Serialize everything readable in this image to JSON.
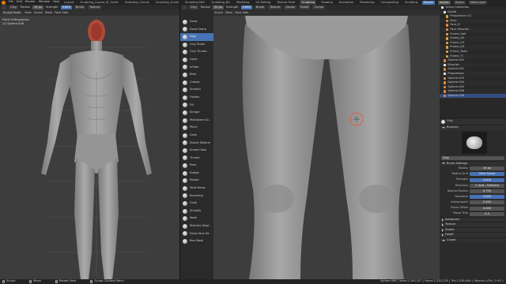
{
  "topbar": {
    "menus": [
      "File",
      "Edit",
      "Render",
      "Window",
      "Help"
    ],
    "workspaces": [
      "Layout",
      "Sculpting_Course_M_Guide",
      "Sculpting_Course",
      "Sculpting_Guide",
      "Sculpting Mini",
      "Sculpting_BG",
      "Modeling",
      "UV Editing",
      "Texture Paint",
      "Shading",
      "Animation",
      "Rendering",
      "Compositing",
      "Scripting"
    ],
    "active_workspace": "Sculpting",
    "scene": "Scene",
    "view_layer": "View Layer",
    "buttons": [
      "Export",
      "Import"
    ]
  },
  "left_header": {
    "brush": "Clay",
    "radius_label": "Radius",
    "radius": "34 px",
    "strength_label": "Strength",
    "strength": "0.600",
    "brush_menu": "Brush",
    "texture_menu": "Texture"
  },
  "left_subheader": {
    "mode": "Sculpt Mode",
    "menus": [
      "View",
      "Sculpt",
      "Mask",
      "Face Sets"
    ]
  },
  "left_viewport": {
    "view": "Front Orthographic",
    "object": "(1) Sphere.008"
  },
  "right_header": {
    "brush": "Clay",
    "radius_label": "Radius",
    "radius": "34 px",
    "strength_label": "Strength",
    "strength": "0.600",
    "brush_menu": "Brush",
    "texture_menu": "Texture",
    "stroke_menu": "Stroke",
    "falloff_menu": "Falloff",
    "cursor_menu": "Cursor"
  },
  "right_subheader": {
    "mode": "Sculpt Mode",
    "menus": [
      "View",
      "Sculpt",
      "Mask",
      "Face Sets"
    ]
  },
  "right_viewport": {
    "view": "Front Orthographic",
    "object": "(1) Sphere.008"
  },
  "tools": [
    "Draw",
    "Draw Sharp",
    "Clay",
    "Clay Strips",
    "Clay Thumb",
    "Layer",
    "Inflate",
    "Blob",
    "Crease",
    "Smooth",
    "Flatten",
    "Fill",
    "Scrape",
    "Multiplane Sc..",
    "Pinch",
    "Grab",
    "Elastic Deform",
    "Snake Hook",
    "Thumb",
    "Pose",
    "Nudge",
    "Rotate",
    "Slide Relax",
    "Boundary",
    "Cloth",
    "Simplify",
    "Mask",
    "Multires Displ..",
    "Draw Face Se..",
    "Box Mask"
  ],
  "active_tool": "Clay",
  "outliner": {
    "title": "Scene Collection",
    "rows": [
      "Scene Collection",
      "Guide",
      "Proportions CS",
      "Face",
      "Face_R",
      "Face Muscles",
      "Frame_Half",
      "Frame_H2",
      "Frame_H3",
      "Frame_H4",
      "Frame_Tools",
      "Frame_Tl",
      "Sphere.002",
      "Muscles",
      "Sphere.001",
      "Proportions",
      "Sphere.003",
      "Sphere.004",
      "Sphere.005",
      "Sphere.006",
      "Sphere.008"
    ],
    "selected": "Sphere.008"
  },
  "properties": {
    "tool_name": "Clay",
    "brushes_label": "Brushes",
    "brush_name": "Clay",
    "brush_settings_label": "Brush Settings",
    "rows": [
      {
        "label": "Radius",
        "value": "34 px"
      },
      {
        "label": "Radius Unit",
        "value": "View   Scene"
      },
      {
        "label": "Strength",
        "value": "0.600"
      },
      {
        "label": "Direction",
        "value": "+ Add   - Subtract"
      },
      {
        "label": "Normal Radius",
        "value": "0.750"
      },
      {
        "label": "Hardness",
        "value": "0.650"
      },
      {
        "label": "Autosmooth",
        "value": "0.000"
      },
      {
        "label": "Plane Offset",
        "value": "0.000"
      },
      {
        "label": "Plane Trim",
        "value": "0.5"
      }
    ],
    "sections": [
      "Advanced",
      "Texture",
      "Stroke",
      "Falloff",
      "Cursor"
    ]
  },
  "statusbar": {
    "items": [
      "Sculpt",
      "Move",
      "Rotate View",
      "Sculpt Context Menu"
    ],
    "right": "Sphere.008 | Verts:2,345,327 | Faces:2,333,278 | Tris:2,338,406 | Objects:1/29 | 2.93.1"
  },
  "colors": {
    "accent": "#4772b3",
    "bg": "#3d3d3d",
    "figure": "#9a9a9a",
    "orange": "#e87d0d"
  }
}
